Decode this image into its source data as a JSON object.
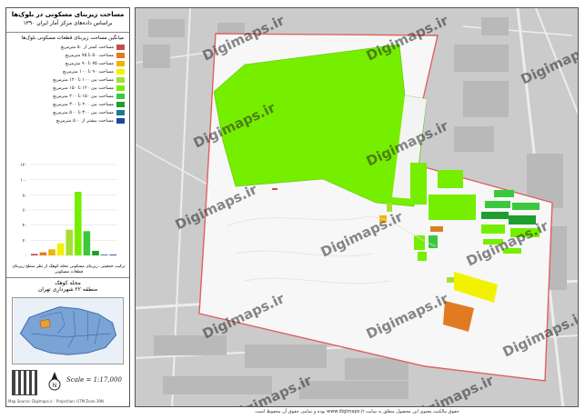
{
  "title": {
    "line1": "مساحت زیربنای مسکونی در بلوک‌ها",
    "line2": "براساس داده‌های مرکز آمار ایران ۱۳۹۰"
  },
  "legend": {
    "heading": "میانگین مساحت زیربنای قطعات مسکونی بلوک‌ها",
    "items": [
      {
        "label": "مساحت کمتر از ۵۰ مترمربع",
        "color": "#c0504d"
      },
      {
        "label": "مساحت ۵۰ تا ۷۵ مترمربع",
        "color": "#e07b22"
      },
      {
        "label": "مساحت ۷۵ تا ۹۰ مترمربع",
        "color": "#f0b400"
      },
      {
        "label": "مساحت ۹۰ تا ۱۰۰ مترمربع",
        "color": "#f2f200"
      },
      {
        "label": "مساحت بین ۱۰۰ تا ۱۲۰ مترمربع",
        "color": "#a5e030"
      },
      {
        "label": "مساحت بین ۱۲۰ تا ۱۵۰ مترمربع",
        "color": "#76ee00"
      },
      {
        "label": "مساحت بین ۱۵۰ تا ۲۰۰ مترمربع",
        "color": "#3cc83c"
      },
      {
        "label": "مساحت بین ۲۰۰ تا ۳۰۰ مترمربع",
        "color": "#1e9e2e"
      },
      {
        "label": "مساحت بین ۳۰۰ تا ۵۰۰ مترمربع",
        "color": "#1a7c8a"
      },
      {
        "label": "مساحت بیشتر از ۵۰۰ مترمربع",
        "color": "#1a4a9a"
      }
    ]
  },
  "histogram": {
    "caption": "ترکیب جمعیتی، زیربنای مسکونی محله کوهک از نظر سطح زیربنای قطعات مسکونی",
    "ticks": [
      "۰",
      "۲۰",
      "۴۰",
      "۶۰",
      "۸۰",
      "۱۰۰",
      "۱۲۰"
    ],
    "values": [
      2,
      4,
      8,
      16,
      34,
      84,
      32,
      6,
      1,
      1
    ]
  },
  "inset": {
    "neighborhood": "محله کوهک",
    "district": "منطقه ۲۲ شهرداری تهران"
  },
  "scale": "Scale = 1:17,000",
  "credit": "Map Source: Digimaps.ir - Projection: UTM Zone 39N",
  "watermark": "Digimaps.ir",
  "footer": "حقوق مالکیت معنوی این محصول متعلق به سایت www.digimaps.ir بوده و تمامی حقوق آن محفوظ است."
}
